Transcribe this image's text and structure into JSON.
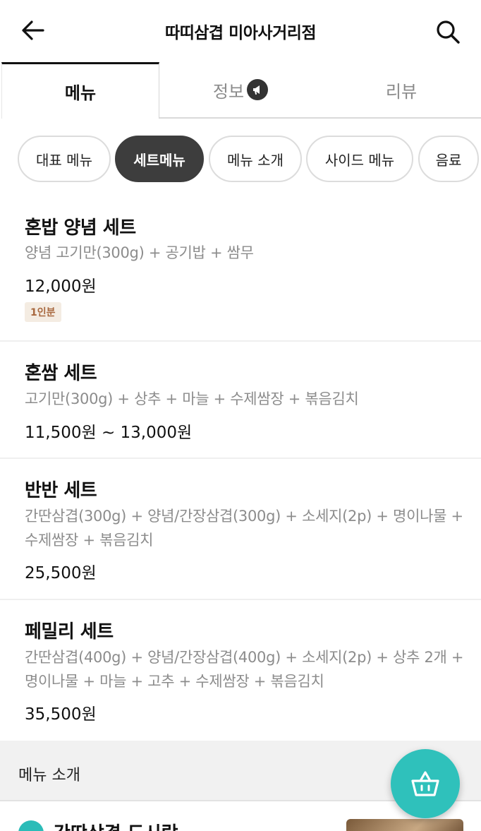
{
  "header": {
    "title": "따띠삼겹 미아사거리점",
    "back_icon": "arrow-left-icon",
    "search_icon": "search-icon"
  },
  "tabs": [
    {
      "label": "메뉴",
      "active": true
    },
    {
      "label": "정보",
      "active": false,
      "icon": "megaphone-icon"
    },
    {
      "label": "리뷰",
      "active": false
    }
  ],
  "categories": [
    {
      "label": "대표 메뉴",
      "active": false
    },
    {
      "label": "세트메뉴",
      "active": true
    },
    {
      "label": "메뉴 소개",
      "active": false
    },
    {
      "label": "사이드 메뉴",
      "active": false
    },
    {
      "label": "음료",
      "active": false
    }
  ],
  "menu_items": [
    {
      "name": "혼밥 양념 세트",
      "description": "양념 고기만(300g) + 공기밥 + 쌈무",
      "price": "12,000원",
      "badge": "1인분"
    },
    {
      "name": "혼쌈 세트",
      "description": "고기만(300g) + 상추 + 마늘 + 수제쌈장 + 볶음김치",
      "price": "11,500원 ~ 13,000원"
    },
    {
      "name": "반반 세트",
      "description": "간딴삼겹(300g) + 양념/간장삼겹(300g) + 소세지(2p) + 명이나물 + 수제쌈장 + 볶음김치",
      "price": "25,500원"
    },
    {
      "name": "페밀리 세트",
      "description": "간딴삼겹(400g) + 양념/간장삼겹(400g) + 소세지(2p) + 상추 2개 + 명이나물 + 마늘 + 고추 + 수제쌈장 + 볶음김치",
      "price": "35,500원"
    }
  ],
  "section": {
    "title": "메뉴 소개"
  },
  "peek_item": {
    "name": "간딴삼겹 도시락"
  },
  "cart": {
    "icon": "basket-icon"
  },
  "colors": {
    "accent": "#2fc1bb",
    "active_chip": "#3d3d3d",
    "badge_bg": "#f4ece2",
    "badge_text": "#a8683f"
  }
}
